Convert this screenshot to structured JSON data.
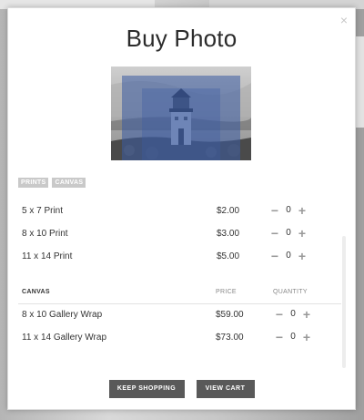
{
  "modal": {
    "title": "Buy Photo",
    "close_glyph": "×"
  },
  "photo": {
    "icon": "lighthouse-photo",
    "overlay_color": "#3b5ba3"
  },
  "tabs": [
    "PRINTS",
    "CANVAS"
  ],
  "prints": [
    {
      "name": "5 x 7 Print",
      "price": "$2.00",
      "qty": "0"
    },
    {
      "name": "8 x 10 Print",
      "price": "$3.00",
      "qty": "0"
    },
    {
      "name": "11 x 14 Print",
      "price": "$5.00",
      "qty": "0"
    }
  ],
  "canvas": {
    "header": {
      "category": "CANVAS",
      "price": "PRICE",
      "quantity": "QUANTITY"
    },
    "items": [
      {
        "name": "8 x 10 Gallery Wrap",
        "price": "$59.00",
        "qty": "0"
      },
      {
        "name": "11 x 14 Gallery Wrap",
        "price": "$73.00",
        "qty": "0"
      }
    ]
  },
  "stepper": {
    "minus": "−",
    "plus": "+"
  },
  "buttons": {
    "keep_shopping": "KEEP SHOPPING",
    "view_cart": "VIEW CART"
  }
}
